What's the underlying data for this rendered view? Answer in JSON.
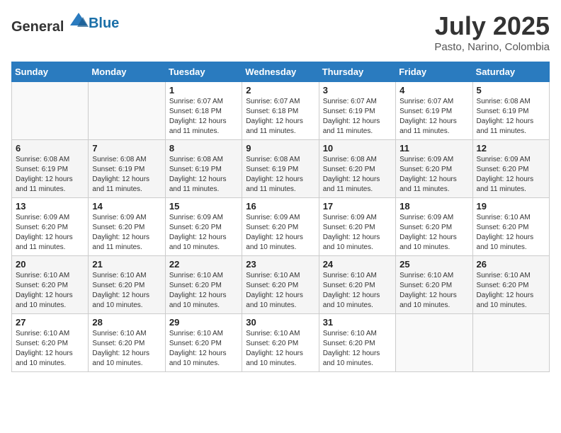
{
  "header": {
    "logo_general": "General",
    "logo_blue": "Blue",
    "title": "July 2025",
    "subtitle": "Pasto, Narino, Colombia"
  },
  "calendar": {
    "days_of_week": [
      "Sunday",
      "Monday",
      "Tuesday",
      "Wednesday",
      "Thursday",
      "Friday",
      "Saturday"
    ],
    "weeks": [
      [
        {
          "day": "",
          "info": ""
        },
        {
          "day": "",
          "info": ""
        },
        {
          "day": "1",
          "info": "Sunrise: 6:07 AM\nSunset: 6:18 PM\nDaylight: 12 hours and 11 minutes."
        },
        {
          "day": "2",
          "info": "Sunrise: 6:07 AM\nSunset: 6:18 PM\nDaylight: 12 hours and 11 minutes."
        },
        {
          "day": "3",
          "info": "Sunrise: 6:07 AM\nSunset: 6:19 PM\nDaylight: 12 hours and 11 minutes."
        },
        {
          "day": "4",
          "info": "Sunrise: 6:07 AM\nSunset: 6:19 PM\nDaylight: 12 hours and 11 minutes."
        },
        {
          "day": "5",
          "info": "Sunrise: 6:08 AM\nSunset: 6:19 PM\nDaylight: 12 hours and 11 minutes."
        }
      ],
      [
        {
          "day": "6",
          "info": "Sunrise: 6:08 AM\nSunset: 6:19 PM\nDaylight: 12 hours and 11 minutes."
        },
        {
          "day": "7",
          "info": "Sunrise: 6:08 AM\nSunset: 6:19 PM\nDaylight: 12 hours and 11 minutes."
        },
        {
          "day": "8",
          "info": "Sunrise: 6:08 AM\nSunset: 6:19 PM\nDaylight: 12 hours and 11 minutes."
        },
        {
          "day": "9",
          "info": "Sunrise: 6:08 AM\nSunset: 6:19 PM\nDaylight: 12 hours and 11 minutes."
        },
        {
          "day": "10",
          "info": "Sunrise: 6:08 AM\nSunset: 6:20 PM\nDaylight: 12 hours and 11 minutes."
        },
        {
          "day": "11",
          "info": "Sunrise: 6:09 AM\nSunset: 6:20 PM\nDaylight: 12 hours and 11 minutes."
        },
        {
          "day": "12",
          "info": "Sunrise: 6:09 AM\nSunset: 6:20 PM\nDaylight: 12 hours and 11 minutes."
        }
      ],
      [
        {
          "day": "13",
          "info": "Sunrise: 6:09 AM\nSunset: 6:20 PM\nDaylight: 12 hours and 11 minutes."
        },
        {
          "day": "14",
          "info": "Sunrise: 6:09 AM\nSunset: 6:20 PM\nDaylight: 12 hours and 11 minutes."
        },
        {
          "day": "15",
          "info": "Sunrise: 6:09 AM\nSunset: 6:20 PM\nDaylight: 12 hours and 10 minutes."
        },
        {
          "day": "16",
          "info": "Sunrise: 6:09 AM\nSunset: 6:20 PM\nDaylight: 12 hours and 10 minutes."
        },
        {
          "day": "17",
          "info": "Sunrise: 6:09 AM\nSunset: 6:20 PM\nDaylight: 12 hours and 10 minutes."
        },
        {
          "day": "18",
          "info": "Sunrise: 6:09 AM\nSunset: 6:20 PM\nDaylight: 12 hours and 10 minutes."
        },
        {
          "day": "19",
          "info": "Sunrise: 6:10 AM\nSunset: 6:20 PM\nDaylight: 12 hours and 10 minutes."
        }
      ],
      [
        {
          "day": "20",
          "info": "Sunrise: 6:10 AM\nSunset: 6:20 PM\nDaylight: 12 hours and 10 minutes."
        },
        {
          "day": "21",
          "info": "Sunrise: 6:10 AM\nSunset: 6:20 PM\nDaylight: 12 hours and 10 minutes."
        },
        {
          "day": "22",
          "info": "Sunrise: 6:10 AM\nSunset: 6:20 PM\nDaylight: 12 hours and 10 minutes."
        },
        {
          "day": "23",
          "info": "Sunrise: 6:10 AM\nSunset: 6:20 PM\nDaylight: 12 hours and 10 minutes."
        },
        {
          "day": "24",
          "info": "Sunrise: 6:10 AM\nSunset: 6:20 PM\nDaylight: 12 hours and 10 minutes."
        },
        {
          "day": "25",
          "info": "Sunrise: 6:10 AM\nSunset: 6:20 PM\nDaylight: 12 hours and 10 minutes."
        },
        {
          "day": "26",
          "info": "Sunrise: 6:10 AM\nSunset: 6:20 PM\nDaylight: 12 hours and 10 minutes."
        }
      ],
      [
        {
          "day": "27",
          "info": "Sunrise: 6:10 AM\nSunset: 6:20 PM\nDaylight: 12 hours and 10 minutes."
        },
        {
          "day": "28",
          "info": "Sunrise: 6:10 AM\nSunset: 6:20 PM\nDaylight: 12 hours and 10 minutes."
        },
        {
          "day": "29",
          "info": "Sunrise: 6:10 AM\nSunset: 6:20 PM\nDaylight: 12 hours and 10 minutes."
        },
        {
          "day": "30",
          "info": "Sunrise: 6:10 AM\nSunset: 6:20 PM\nDaylight: 12 hours and 10 minutes."
        },
        {
          "day": "31",
          "info": "Sunrise: 6:10 AM\nSunset: 6:20 PM\nDaylight: 12 hours and 10 minutes."
        },
        {
          "day": "",
          "info": ""
        },
        {
          "day": "",
          "info": ""
        }
      ]
    ]
  }
}
